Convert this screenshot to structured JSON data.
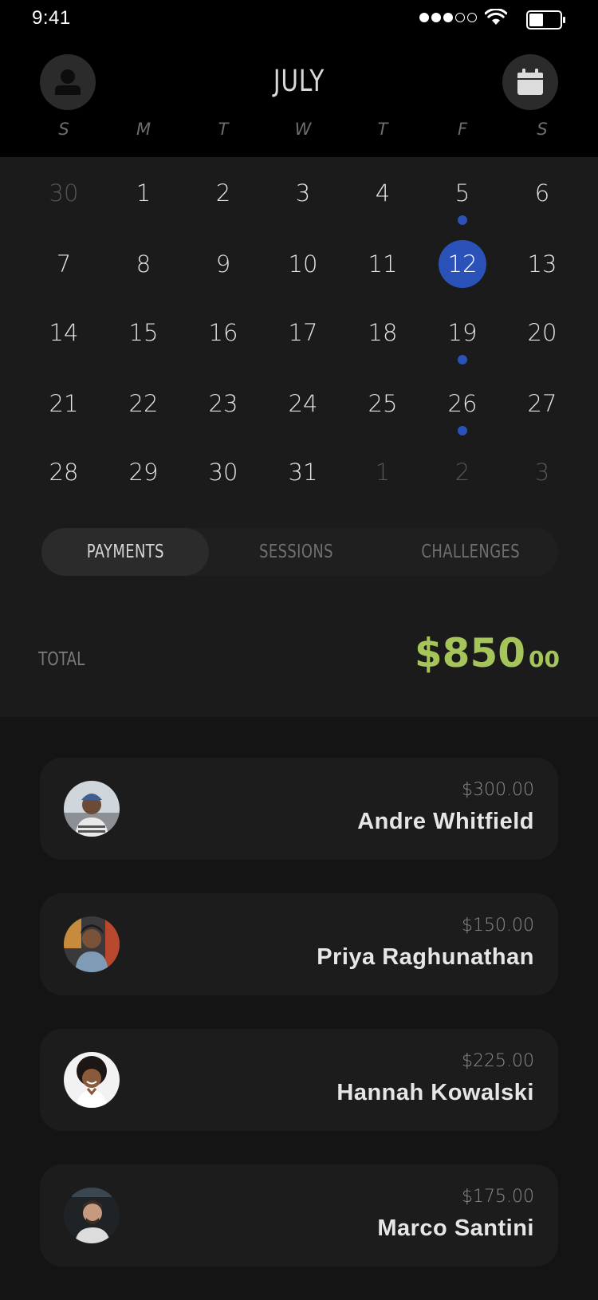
{
  "status_bar": {
    "time": "9:41"
  },
  "header": {
    "month": "JULY"
  },
  "weekdays": [
    "S",
    "M",
    "T",
    "W",
    "T",
    "F",
    "S"
  ],
  "calendar": {
    "weeks": [
      [
        {
          "d": "30",
          "muted": true
        },
        {
          "d": "1"
        },
        {
          "d": "2"
        },
        {
          "d": "3"
        },
        {
          "d": "4"
        },
        {
          "d": "5",
          "dot": true
        },
        {
          "d": "6"
        }
      ],
      [
        {
          "d": "7"
        },
        {
          "d": "8"
        },
        {
          "d": "9"
        },
        {
          "d": "10"
        },
        {
          "d": "11"
        },
        {
          "d": "12",
          "selected": true
        },
        {
          "d": "13"
        }
      ],
      [
        {
          "d": "14"
        },
        {
          "d": "15"
        },
        {
          "d": "16"
        },
        {
          "d": "17"
        },
        {
          "d": "18"
        },
        {
          "d": "19",
          "dot": true
        },
        {
          "d": "20"
        }
      ],
      [
        {
          "d": "21"
        },
        {
          "d": "22"
        },
        {
          "d": "23"
        },
        {
          "d": "24"
        },
        {
          "d": "25"
        },
        {
          "d": "26",
          "dot": true
        },
        {
          "d": "27"
        }
      ],
      [
        {
          "d": "28"
        },
        {
          "d": "29"
        },
        {
          "d": "30"
        },
        {
          "d": "31"
        },
        {
          "d": "1",
          "muted": true
        },
        {
          "d": "2",
          "muted": true
        },
        {
          "d": "3",
          "muted": true
        }
      ]
    ]
  },
  "tabs": [
    {
      "label": "PAYMENTS",
      "active": true
    },
    {
      "label": "SESSIONS"
    },
    {
      "label": "CHALLENGES"
    }
  ],
  "total": {
    "label": "TOTAL",
    "amount": "$850",
    "cents": "00"
  },
  "payments": [
    {
      "amount": "$300.00",
      "name": "Andre Whitfield"
    },
    {
      "amount": "$150.00",
      "name": "Priya Raghunathan"
    },
    {
      "amount": "$225.00",
      "name": "Hannah Kowalski"
    },
    {
      "amount": "$175.00",
      "name": "Marco Santini"
    }
  ],
  "colors": {
    "accent_blue": "#2b52b8",
    "total_green": "#a5c45a",
    "background": "#141414"
  },
  "icons": {
    "profile": "person-icon",
    "calendar": "calendar-icon"
  }
}
